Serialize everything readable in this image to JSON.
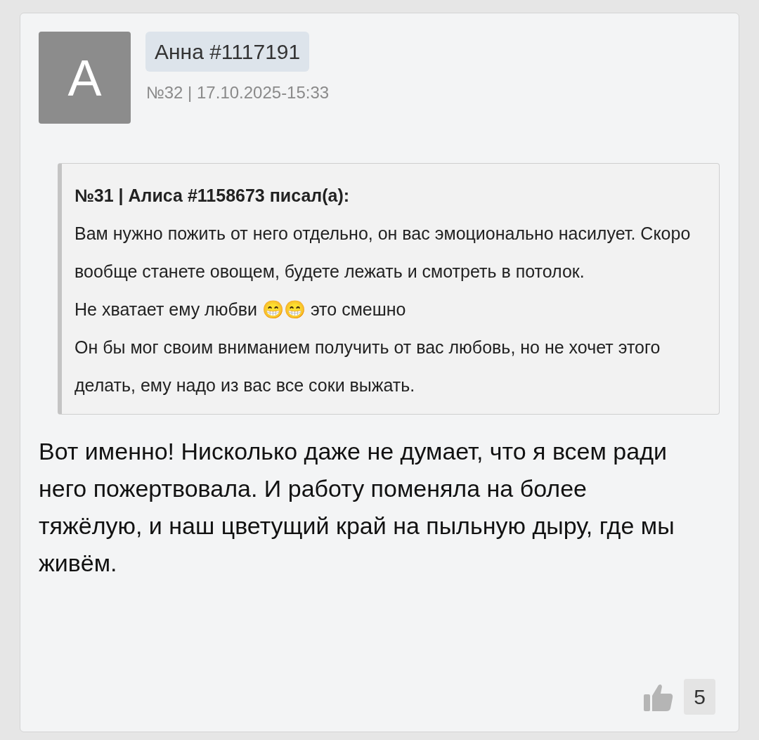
{
  "post": {
    "avatar_letter": "A",
    "author": "Анна #1117191",
    "meta": "№32 | 17.10.2025-15:33",
    "quote": {
      "header": "№31 | Алиса #1158673 писал(а):",
      "paragraphs": [
        "Вам нужно пожить от него отдельно, он вас эмоционально насилует. Скоро вообще станете овощем, будете лежать и смотреть в потолок.",
        "Не хватает ему любви 😁😁 это смешно",
        "Он бы мог своим вниманием получить от вас любовь, но не хочет этого делать, ему надо из вас все соки выжать."
      ]
    },
    "text": "Вот именно! Нисколько даже не думает, что я всем ради него пожертвовала. И работу поменяла на более тяжёлую, и наш цветущий край на пыльную дыру, где мы живём.",
    "likes": "5"
  }
}
